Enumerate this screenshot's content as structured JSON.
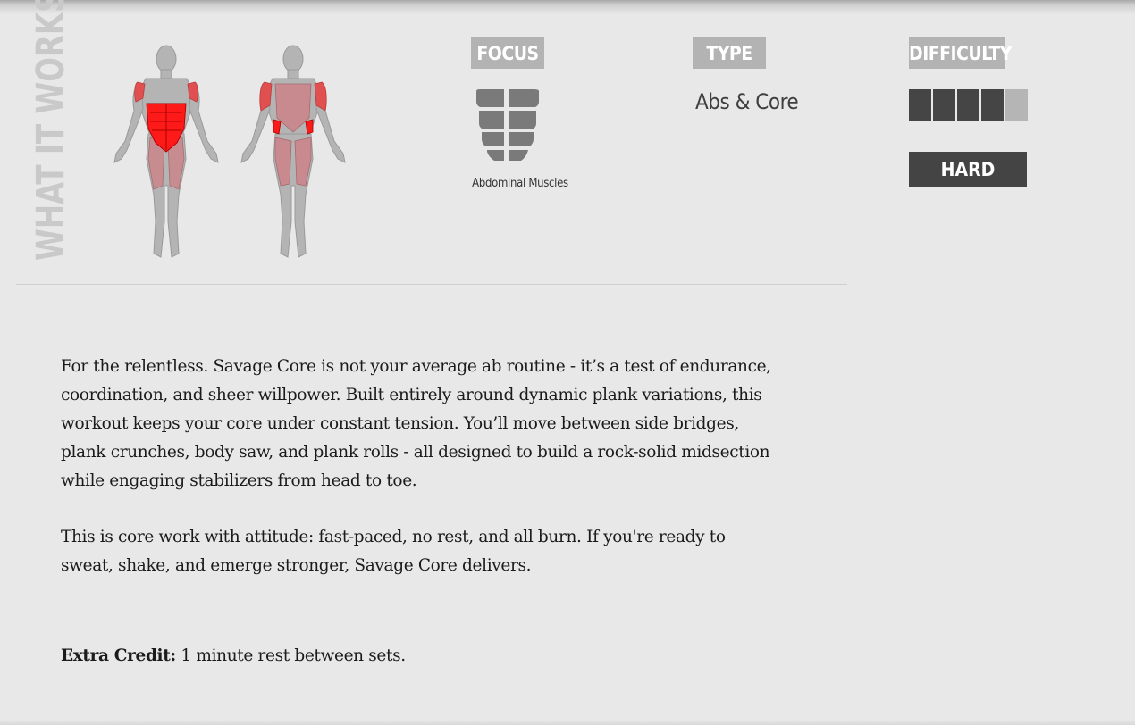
{
  "section_title": "WHAT IT WORKS",
  "focus": {
    "label": "FOCUS",
    "icon": "abdominal-muscles-icon",
    "muscle": "Abdominal Muscles"
  },
  "type": {
    "label": "TYPE",
    "value": "Abs & Core"
  },
  "difficulty": {
    "label": "DIFFICULTY",
    "level": "HARD",
    "rating": 4,
    "max_rating": 5
  },
  "description": {
    "paragraphs": [
      "For the relentless. Savage Core is not your average ab routine - it’s a test of endurance, coordination, and sheer willpower. Built entirely around dynamic plank variations, this workout keeps your core under constant tension. You’ll move between side bridges, plank crunches, body saw, and plank rolls - all designed to build a rock-solid midsection while engaging stabilizers from head to toe.",
      "This is core work with attitude: fast-paced, no rest, and all burn. If you're ready to sweat, shake, and emerge stronger, Savage Core delivers."
    ],
    "extra_credit_label": "Extra Credit:",
    "extra_credit_text": " 1 minute rest between sets."
  },
  "colors": {
    "background": "#e8e8e8",
    "tag": "#b3b3b3",
    "dark": "#444444",
    "muscle_highlight": "#ff1a1a",
    "muscle_secondary": "#d9666a",
    "body": "#b4b4b4"
  }
}
